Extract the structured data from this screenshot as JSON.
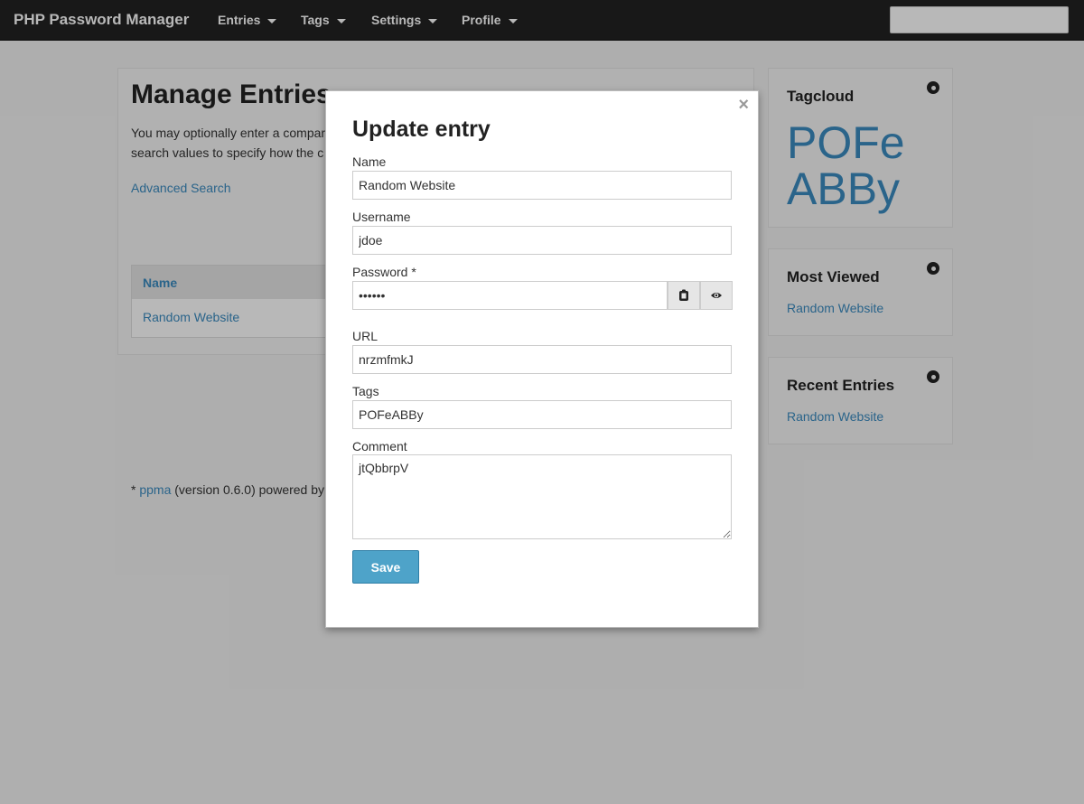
{
  "navbar": {
    "brand": "PHP Password Manager",
    "items": [
      {
        "label": "Entries"
      },
      {
        "label": "Tags"
      },
      {
        "label": "Settings"
      },
      {
        "label": "Profile"
      }
    ],
    "search_value": ""
  },
  "main": {
    "title": "Manage Entries",
    "intro_line1": "You may optionally enter a compar",
    "intro_line2": "search values to specify how the c",
    "advanced_search": "Advanced Search",
    "table": {
      "header_name": "Name",
      "rows": [
        {
          "name": "Random Website"
        }
      ]
    },
    "footer": {
      "prefix": "* ",
      "link": "ppma",
      "suffix": " (version 0.6.0) powered by"
    }
  },
  "sidebar": {
    "tagcloud": {
      "title": "Tagcloud",
      "tags": [
        "POFe",
        "ABBy"
      ]
    },
    "most_viewed": {
      "title": "Most Viewed",
      "items": [
        "Random Website"
      ]
    },
    "recent_entries": {
      "title": "Recent Entries",
      "items": [
        "Random Website"
      ]
    }
  },
  "modal": {
    "close_glyph": "×",
    "title": "Update entry",
    "name_label": "Name",
    "name_value": "Random Website",
    "username_label": "Username",
    "username_value": "jdoe",
    "password_label": "Password *",
    "password_value": "••••••",
    "url_label": "URL",
    "url_value": "nrzmfmkJ",
    "tags_label": "Tags",
    "tags_value": "POFeABBy",
    "comment_label": "Comment",
    "comment_value": "jtQbbrpV",
    "save_label": "Save"
  },
  "colors": {
    "accent": "#3b8bc0",
    "navbar_bg": "#222222",
    "save_button": "#4ea3c9"
  }
}
